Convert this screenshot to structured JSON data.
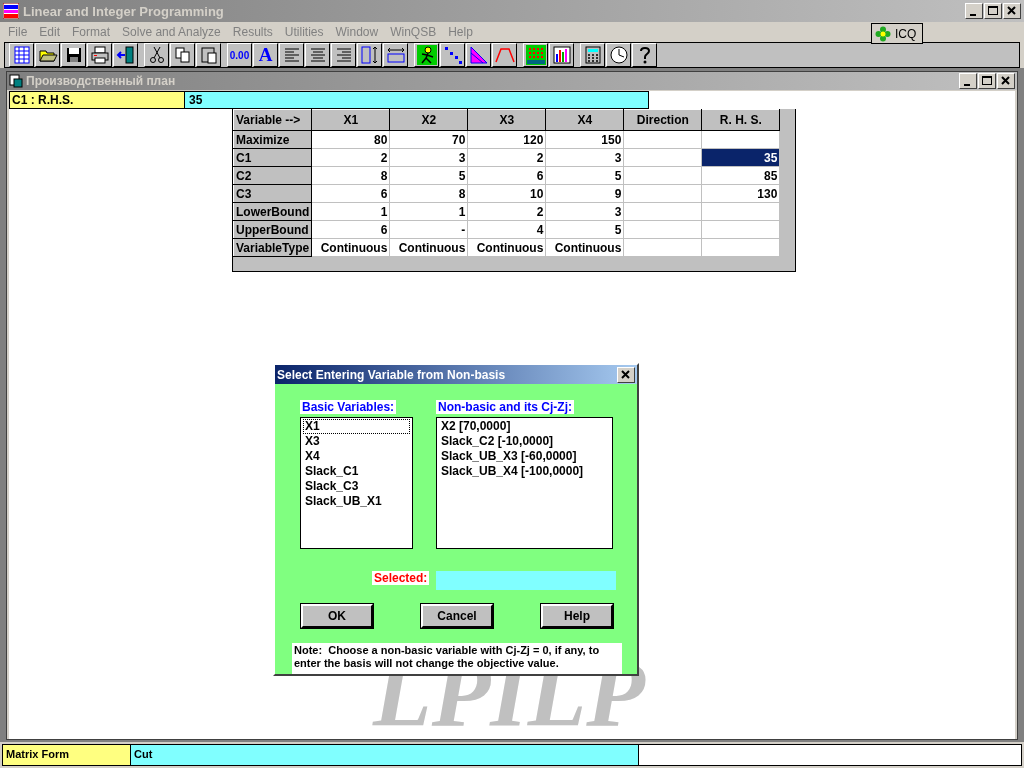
{
  "window": {
    "title": "Linear and Integer Programming"
  },
  "menu": [
    "File",
    "Edit",
    "Format",
    "Solve and Analyze",
    "Results",
    "Utilities",
    "Window",
    "WinQSB",
    "Help"
  ],
  "tray": {
    "label": "ICQ"
  },
  "toolbar": [
    [
      {
        "kind": "new"
      },
      {
        "kind": "open"
      },
      {
        "kind": "save"
      },
      {
        "kind": "print"
      },
      {
        "kind": "exit"
      }
    ],
    [
      {
        "kind": "cut"
      },
      {
        "kind": "copy"
      },
      {
        "kind": "paste"
      }
    ],
    [
      {
        "kind": "number",
        "label": "0.00"
      },
      {
        "kind": "font",
        "label": "A"
      },
      {
        "kind": "align-left"
      },
      {
        "kind": "align-center"
      },
      {
        "kind": "align-right"
      },
      {
        "kind": "col-width"
      },
      {
        "kind": "row-height"
      }
    ],
    [
      {
        "kind": "solve"
      },
      {
        "kind": "steps"
      },
      {
        "kind": "graph"
      },
      {
        "kind": "trapezoid"
      }
    ],
    [
      {
        "kind": "matrix"
      },
      {
        "kind": "bars"
      }
    ],
    [
      {
        "kind": "calculator"
      },
      {
        "kind": "clock"
      },
      {
        "kind": "help"
      }
    ]
  ],
  "document": {
    "title": "Производственный план",
    "cell_ref": "C1 : R.H.S.",
    "cell_value": "35",
    "table": {
      "corner": "Variable -->",
      "columns": [
        "X1",
        "X2",
        "X3",
        "X4",
        "Direction",
        "R. H. S."
      ],
      "rows": [
        {
          "label": "Maximize",
          "cells": [
            {
              "text": "80",
              "selected": false
            },
            {
              "text": "70",
              "selected": false
            },
            {
              "text": "120",
              "selected": false
            },
            {
              "text": "150",
              "selected": false
            },
            {
              "text": "",
              "selected": false
            },
            {
              "text": "",
              "selected": false
            }
          ]
        },
        {
          "label": "C1",
          "cells": [
            {
              "text": "2",
              "selected": false
            },
            {
              "text": "3",
              "selected": false
            },
            {
              "text": "2",
              "selected": false
            },
            {
              "text": "3",
              "selected": false
            },
            {
              "text": "",
              "selected": false
            },
            {
              "text": "35",
              "selected": true
            }
          ]
        },
        {
          "label": "C2",
          "cells": [
            {
              "text": "8",
              "selected": false
            },
            {
              "text": "5",
              "selected": false
            },
            {
              "text": "6",
              "selected": false
            },
            {
              "text": "5",
              "selected": false
            },
            {
              "text": "",
              "selected": false
            },
            {
              "text": "85",
              "selected": false
            }
          ]
        },
        {
          "label": "C3",
          "cells": [
            {
              "text": "6",
              "selected": false
            },
            {
              "text": "8",
              "selected": false
            },
            {
              "text": "10",
              "selected": false
            },
            {
              "text": "9",
              "selected": false
            },
            {
              "text": "",
              "selected": false
            },
            {
              "text": "130",
              "selected": false
            }
          ]
        },
        {
          "label": "LowerBound",
          "cells": [
            {
              "text": "1",
              "selected": false
            },
            {
              "text": "1",
              "selected": false
            },
            {
              "text": "2",
              "selected": false
            },
            {
              "text": "3",
              "selected": false
            },
            {
              "text": "",
              "selected": false
            },
            {
              "text": "",
              "selected": false
            }
          ]
        },
        {
          "label": "UpperBound",
          "cells": [
            {
              "text": "6",
              "selected": false
            },
            {
              "text": "-",
              "selected": false
            },
            {
              "text": "4",
              "selected": false
            },
            {
              "text": "5",
              "selected": false
            },
            {
              "text": "",
              "selected": false
            },
            {
              "text": "",
              "selected": false
            }
          ]
        },
        {
          "label": "VariableType",
          "cells": [
            {
              "text": "Continuous",
              "selected": false
            },
            {
              "text": "Continuous",
              "selected": false
            },
            {
              "text": "Continuous",
              "selected": false
            },
            {
              "text": "Continuous",
              "selected": false
            },
            {
              "text": "",
              "selected": false
            },
            {
              "text": "",
              "selected": false
            }
          ]
        }
      ]
    }
  },
  "background_logo": "LPILP",
  "dialog": {
    "title": "Select Entering Variable from Non-basis",
    "basic_label": "Basic Variables:",
    "basic": [
      {
        "text": "X1",
        "focused": true
      },
      {
        "text": "X3",
        "focused": false
      },
      {
        "text": "X4",
        "focused": false
      },
      {
        "text": "Slack_C1",
        "focused": false
      },
      {
        "text": "Slack_C3",
        "focused": false
      },
      {
        "text": "Slack_UB_X1",
        "focused": false
      }
    ],
    "nonbasic_label": "Non-basic and its Cj-Zj:",
    "nonbasic": [
      {
        "text": "X2 [70,0000]"
      },
      {
        "text": "Slack_C2 [-10,0000]"
      },
      {
        "text": "Slack_UB_X3 [-60,0000]"
      },
      {
        "text": "Slack_UB_X4 [-100,0000]"
      }
    ],
    "selected_label": "Selected:",
    "buttons": [
      "OK",
      "Cancel",
      "Help"
    ],
    "note": "Note:  Choose a non-basic variable with Cj-Zj = 0, if any, to enter the basis will not change the objective value."
  },
  "status_bar": [
    "Matrix Form",
    "Cut"
  ]
}
